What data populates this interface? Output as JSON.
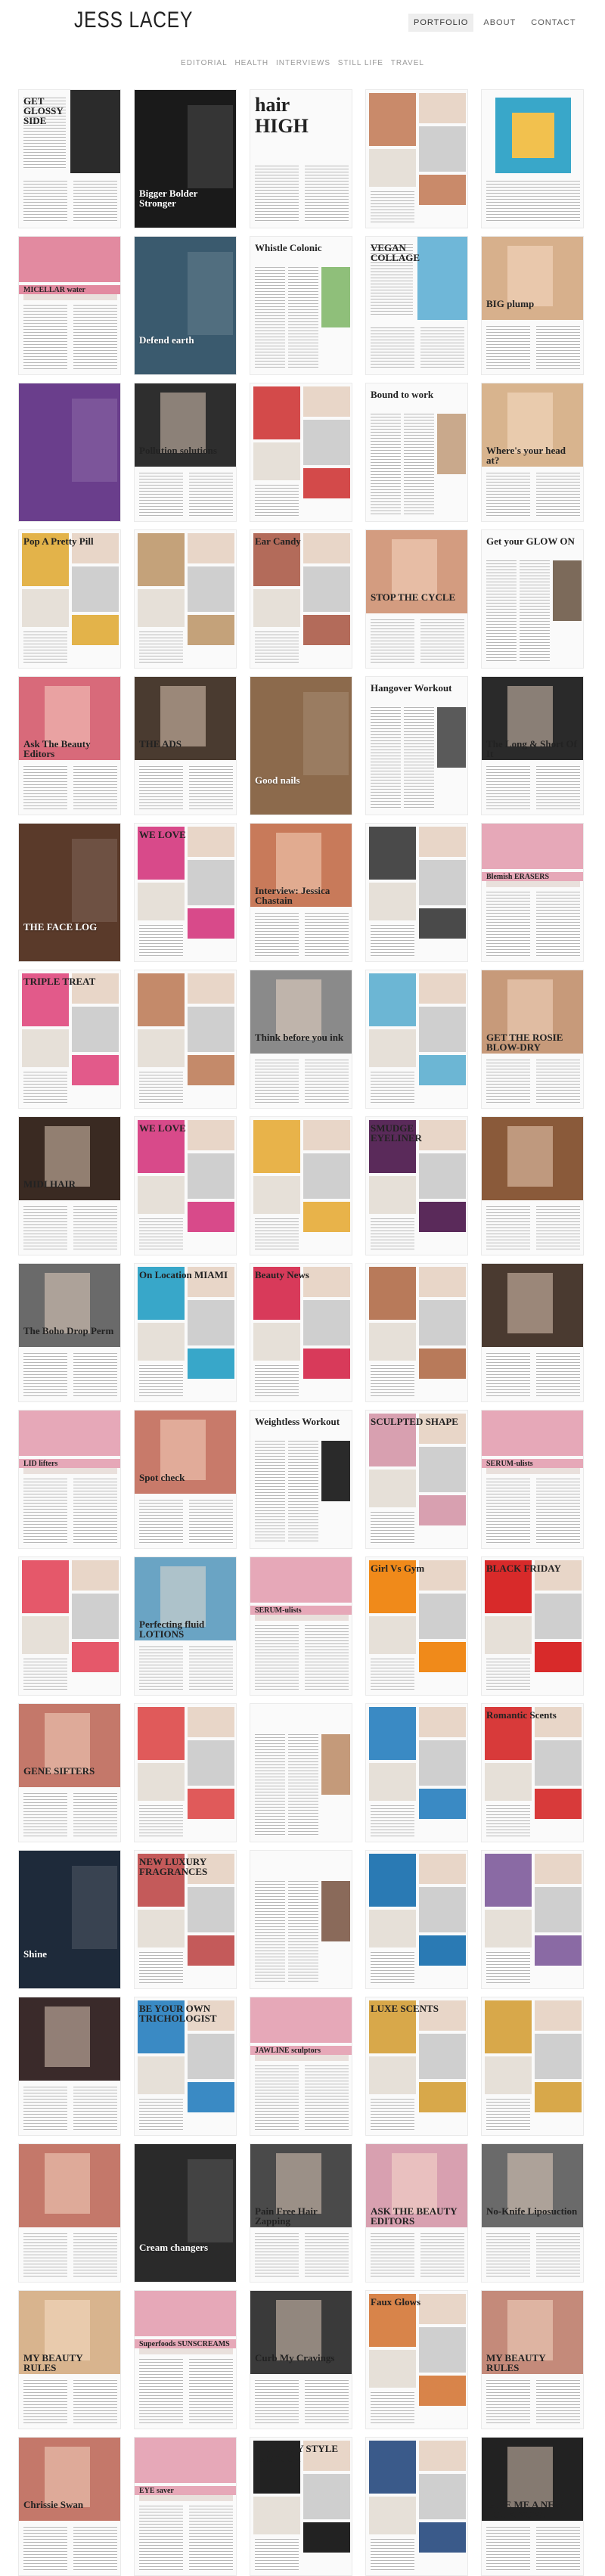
{
  "site": {
    "logo": "JESS LACEY"
  },
  "main_nav": [
    {
      "label": "PORTFOLIO",
      "active": true
    },
    {
      "label": "ABOUT",
      "active": false
    },
    {
      "label": "CONTACT",
      "active": false
    }
  ],
  "sub_nav": [
    "EDITORIAL",
    "HEALTH",
    "INTERVIEWS",
    "STILL LIFE",
    "TRAVEL"
  ],
  "tiles": [
    {
      "title": "GET GLOSSY SIDE",
      "accent": "#2b2b2b",
      "layout": "split",
      "light": false
    },
    {
      "title": "Bigger Bolder Stronger",
      "accent": "#1a1a1a",
      "layout": "dark",
      "light": true
    },
    {
      "title": "hair HIGH",
      "accent": "#111111",
      "layout": "type",
      "light": false
    },
    {
      "title": "",
      "accent": "#c98a6a",
      "layout": "collage",
      "light": false
    },
    {
      "title": "",
      "accent": "#39a7c9",
      "layout": "illus",
      "light": false
    },
    {
      "title": "MICELLAR water",
      "accent": "#e28aa0",
      "layout": "pinkbar",
      "light": false
    },
    {
      "title": "Defend earth",
      "accent": "#3a5a6e",
      "layout": "dark",
      "light": true
    },
    {
      "title": "Whistle Colonic",
      "accent": "#8fbf7a",
      "layout": "text",
      "light": false
    },
    {
      "title": "VEGAN COLLAGE",
      "accent": "#6fb7d8",
      "layout": "split",
      "light": false
    },
    {
      "title": "BIG plump",
      "accent": "#d7b08c",
      "layout": "face",
      "light": false
    },
    {
      "title": "",
      "accent": "#6a3e8c",
      "layout": "dark",
      "light": true
    },
    {
      "title": "Pollution solutions",
      "accent": "#2e2e2e",
      "layout": "face",
      "light": false
    },
    {
      "title": "",
      "accent": "#d34a4a",
      "layout": "collage",
      "light": false
    },
    {
      "title": "Bound to work",
      "accent": "#c9a98c",
      "layout": "text",
      "light": false
    },
    {
      "title": "Where's your head at?",
      "accent": "#d8b48e",
      "layout": "face",
      "light": false
    },
    {
      "title": "Pop A Pretty Pill",
      "accent": "#e3b34a",
      "layout": "collage",
      "light": false
    },
    {
      "title": "",
      "accent": "#c4a27a",
      "layout": "collage",
      "light": false
    },
    {
      "title": "Ear Candy",
      "accent": "#b36b5a",
      "layout": "collage",
      "light": false
    },
    {
      "title": "STOP THE CYCLE",
      "accent": "#d39c80",
      "layout": "face",
      "light": false
    },
    {
      "title": "Get your GLOW ON",
      "accent": "#7c6a5a",
      "layout": "text",
      "light": false
    },
    {
      "title": "Ask The Beauty Editors",
      "accent": "#d86a7a",
      "layout": "face",
      "light": false
    },
    {
      "title": "THE ADS",
      "accent": "#4a3b30",
      "layout": "face",
      "light": false
    },
    {
      "title": "Good nails",
      "accent": "#8c6a4c",
      "layout": "dark",
      "light": true
    },
    {
      "title": "Hangover Workout",
      "accent": "#5a5a5a",
      "layout": "text",
      "light": false
    },
    {
      "title": "The Long & Short Of It",
      "accent": "#2a2a2a",
      "layout": "face",
      "light": false
    },
    {
      "title": "THE FACE LOG",
      "accent": "#5a3a2a",
      "layout": "dark",
      "light": true
    },
    {
      "title": "WE LOVE",
      "accent": "#d84a8a",
      "layout": "collage",
      "light": false
    },
    {
      "title": "Interview: Jessica Chastain",
      "accent": "#c87a5a",
      "layout": "face",
      "light": false
    },
    {
      "title": "",
      "accent": "#4a4a4a",
      "layout": "collage",
      "light": false
    },
    {
      "title": "Blemish ERASERS",
      "accent": "#e6a8b8",
      "layout": "pinkbar",
      "light": false
    },
    {
      "title": "TRIPLE TREAT",
      "accent": "#e25a8a",
      "layout": "collage",
      "light": false
    },
    {
      "title": "",
      "accent": "#c48a6a",
      "layout": "collage",
      "light": false
    },
    {
      "title": "Think before you ink",
      "accent": "#8a8a8a",
      "layout": "face",
      "light": false
    },
    {
      "title": "",
      "accent": "#6cb6d4",
      "layout": "collage",
      "light": false
    },
    {
      "title": "GET THE ROSIE BLOW-DRY",
      "accent": "#c79a7a",
      "layout": "face",
      "light": false
    },
    {
      "title": "MIDI HAIR",
      "accent": "#3a2a22",
      "layout": "face",
      "light": false
    },
    {
      "title": "WE LOVE",
      "accent": "#d84a8a",
      "layout": "collage",
      "light": false
    },
    {
      "title": "",
      "accent": "#e8b34a",
      "layout": "collage",
      "light": false
    },
    {
      "title": "SMUDGE EYELINER",
      "accent": "#5a2a5a",
      "layout": "collage",
      "light": false
    },
    {
      "title": "",
      "accent": "#8a5a3a",
      "layout": "face",
      "light": false
    },
    {
      "title": "The Boho Drop Perm",
      "accent": "#6a6a6a",
      "layout": "face",
      "light": false
    },
    {
      "title": "On Location MIAMI",
      "accent": "#38a7c9",
      "layout": "collage",
      "light": false
    },
    {
      "title": "Beauty News",
      "accent": "#d83a5a",
      "layout": "collage",
      "light": false
    },
    {
      "title": "",
      "accent": "#b87a5a",
      "layout": "collage",
      "light": false
    },
    {
      "title": "",
      "accent": "#4a3a30",
      "layout": "face",
      "light": false
    },
    {
      "title": "LID lifters",
      "accent": "#e6a8b8",
      "layout": "pinkbar",
      "light": false
    },
    {
      "title": "Spot check",
      "accent": "#c87a6a",
      "layout": "face",
      "light": false
    },
    {
      "title": "Weightless Workout",
      "accent": "#2a2a2a",
      "layout": "text",
      "light": false
    },
    {
      "title": "SCULPTED SHAPE",
      "accent": "#d8a0b0",
      "layout": "collage",
      "light": false
    },
    {
      "title": "SERUM-ulists",
      "accent": "#e6a8b8",
      "layout": "pinkbar",
      "light": false
    },
    {
      "title": "",
      "accent": "#e5586a",
      "layout": "collage",
      "light": false
    },
    {
      "title": "Perfecting fluid LOTIONS",
      "accent": "#6aa4c4",
      "layout": "face",
      "light": false
    },
    {
      "title": "SERUM-ulists",
      "accent": "#e6a8b8",
      "layout": "pinkbar",
      "light": false
    },
    {
      "title": "Girl Vs Gym",
      "accent": "#f08a1a",
      "layout": "collage",
      "light": false
    },
    {
      "title": "BLACK FRIDAY",
      "accent": "#d82a2a",
      "layout": "collage",
      "light": false
    },
    {
      "title": "GENE SIFTERS",
      "accent": "#c4786a",
      "layout": "face",
      "light": false
    },
    {
      "title": "",
      "accent": "#e05a5a",
      "layout": "collage",
      "light": false
    },
    {
      "title": "",
      "accent": "#c49a7a",
      "layout": "text",
      "light": false
    },
    {
      "title": "",
      "accent": "#3a8ac4",
      "layout": "collage",
      "light": false
    },
    {
      "title": "Romantic Scents",
      "accent": "#d83a3a",
      "layout": "collage",
      "light": false
    },
    {
      "title": "Shine",
      "accent": "#1e2a3a",
      "layout": "dark",
      "light": true
    },
    {
      "title": "NEW LUXURY FRAGRANCES",
      "accent": "#c45a5a",
      "layout": "collage",
      "light": false
    },
    {
      "title": "",
      "accent": "#8a6a5a",
      "layout": "text",
      "light": false
    },
    {
      "title": "",
      "accent": "#2a7ab4",
      "layout": "collage",
      "light": false
    },
    {
      "title": "",
      "accent": "#8a6aa4",
      "layout": "collage",
      "light": false
    },
    {
      "title": "",
      "accent": "#3a2a2a",
      "layout": "face",
      "light": false
    },
    {
      "title": "BE YOUR OWN TRICHOLOGIST",
      "accent": "#3a8ac4",
      "layout": "collage",
      "light": false
    },
    {
      "title": "JAWLINE sculptors",
      "accent": "#e6a8b8",
      "layout": "pinkbar",
      "light": false
    },
    {
      "title": "LUXE SCENTS",
      "accent": "#d8a84a",
      "layout": "collage",
      "light": false
    },
    {
      "title": "",
      "accent": "#d8a84a",
      "layout": "collage",
      "light": false
    },
    {
      "title": "",
      "accent": "#c4786a",
      "layout": "face",
      "light": false
    },
    {
      "title": "Cream changers",
      "accent": "#2a2a2a",
      "layout": "dark",
      "light": true
    },
    {
      "title": "Pain Free Hair Zapping",
      "accent": "#4a4a4a",
      "layout": "face",
      "light": false
    },
    {
      "title": "ASK THE BEAUTY EDITORS",
      "accent": "#d8a0b0",
      "layout": "face",
      "light": false
    },
    {
      "title": "No-Knife Liposuction",
      "accent": "#6a6a6a",
      "layout": "face",
      "light": false
    },
    {
      "title": "MY BEAUTY RULES",
      "accent": "#d8b48e",
      "layout": "face",
      "light": false
    },
    {
      "title": "Superfoods SUNSCREAMS",
      "accent": "#e6a8b8",
      "layout": "pinkbar",
      "light": false
    },
    {
      "title": "Curb My Cravings",
      "accent": "#3a3a3a",
      "layout": "face",
      "light": false
    },
    {
      "title": "Faux Glows",
      "accent": "#d8844a",
      "layout": "collage",
      "light": false
    },
    {
      "title": "MY BEAUTY RULES",
      "accent": "#c48a7a",
      "layout": "face",
      "light": false
    },
    {
      "title": "Chrissie Swan",
      "accent": "#c4786a",
      "layout": "face",
      "light": false
    },
    {
      "title": "EYE saver",
      "accent": "#e6a8b8",
      "layout": "pinkbar",
      "light": false
    },
    {
      "title": "HELP! MY STYLE IS STUCK",
      "accent": "#222222",
      "layout": "collage",
      "light": false
    },
    {
      "title": "",
      "accent": "#3a5a8a",
      "layout": "collage",
      "light": false
    },
    {
      "title": "GIVE ME A NEW LOOK NOW!",
      "accent": "#222222",
      "layout": "face",
      "light": false
    }
  ]
}
